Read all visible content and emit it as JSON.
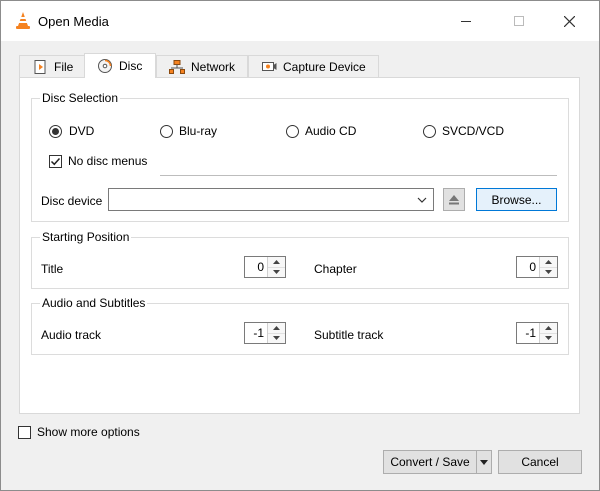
{
  "window": {
    "title": "Open Media"
  },
  "tabs": [
    {
      "label": "File",
      "icon": "file-icon"
    },
    {
      "label": "Disc",
      "icon": "disc-icon",
      "active": true
    },
    {
      "label": "Network",
      "icon": "network-icon"
    },
    {
      "label": "Capture Device",
      "icon": "capture-device-icon"
    }
  ],
  "disc_selection": {
    "title": "Disc Selection",
    "options": [
      "DVD",
      "Blu-ray",
      "Audio CD",
      "SVCD/VCD"
    ],
    "selected": "DVD",
    "no_disc_menus": {
      "label": "No disc menus",
      "checked": true
    },
    "device_label": "Disc device",
    "device_value": "",
    "browse_label": "Browse..."
  },
  "starting_position": {
    "title": "Starting Position",
    "title_label": "Title",
    "title_value": "0",
    "chapter_label": "Chapter",
    "chapter_value": "0"
  },
  "audio_subtitles": {
    "title": "Audio and Subtitles",
    "audio_label": "Audio track",
    "audio_value": "-1",
    "subtitle_label": "Subtitle track",
    "subtitle_value": "-1"
  },
  "footer": {
    "show_more_label": "Show more options",
    "show_more_checked": false,
    "convert_label": "Convert / Save",
    "cancel_label": "Cancel"
  },
  "colors": {
    "accent": "#0078d7",
    "vlc_orange": "#f58220"
  }
}
